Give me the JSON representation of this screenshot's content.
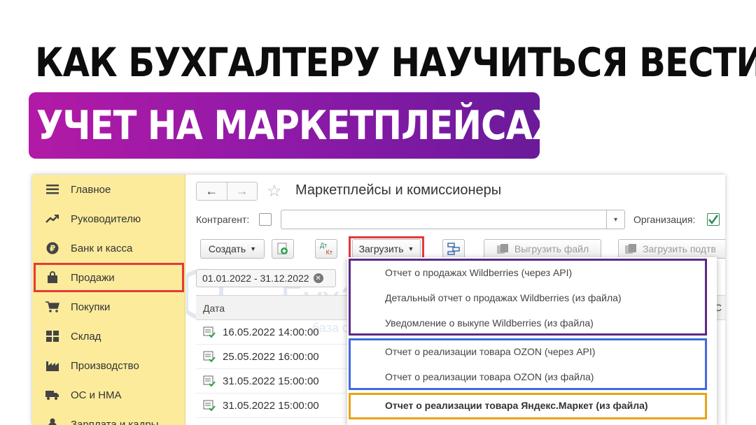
{
  "headline": {
    "line1": "КАК БУХГАЛТЕРУ НАУЧИТЬСЯ ВЕСТИ",
    "line2": "УЧЕТ НА МАРКЕТПЛЕЙСАХ"
  },
  "colors": {
    "banner_gradient": [
      "#b21aa6",
      "#6a1a9a"
    ],
    "sidebar_bg": "#fbeb9b",
    "highlight_red": "#e33a3a",
    "highlight_purple": "#5b2a86",
    "highlight_blue": "#4169e1",
    "highlight_orange": "#e8a317"
  },
  "sidebar": {
    "items": [
      {
        "label": "Главное",
        "icon": "menu-icon"
      },
      {
        "label": "Руководителю",
        "icon": "trend-icon"
      },
      {
        "label": "Банк и касса",
        "icon": "ruble-icon"
      },
      {
        "label": "Продажи",
        "icon": "shopping-bag-icon",
        "active": true
      },
      {
        "label": "Покупки",
        "icon": "cart-icon"
      },
      {
        "label": "Склад",
        "icon": "warehouse-icon"
      },
      {
        "label": "Производство",
        "icon": "factory-icon"
      },
      {
        "label": "ОС и НМА",
        "icon": "truck-icon"
      },
      {
        "label": "Зарплата и кадры",
        "icon": "person-icon"
      }
    ]
  },
  "window": {
    "title": "Маркетплейсы и комиссионеры",
    "nav_back": "←",
    "nav_forward": "→",
    "star": "☆"
  },
  "filters": {
    "counterparty_label": "Контрагент:",
    "counterparty_value": "",
    "organization_label": "Организация:"
  },
  "toolbar": {
    "create": "Создать",
    "dtkt_top": "Дт",
    "dtkt_bottom": "Кт",
    "load": "Загрузить",
    "export_file": "Выгрузить файл",
    "load_confirm": "Загрузить подтв"
  },
  "period": "01.01.2022 - 31.12.2022",
  "table": {
    "headers": [
      "Дата",
      "С"
    ],
    "rows": [
      "16.05.2022 14:00:00",
      "25.05.2022 16:00:00",
      "31.05.2022 15:00:00",
      "31.05.2022 15:00:00"
    ]
  },
  "load_menu": {
    "items": [
      "Отчет о продажах Wildberries (через API)",
      "Детальный отчет о продажах Wildberries (из файла)",
      "Уведомление о выкупе Wildberries (из файла)",
      "Отчет о реализации товара OZON (через API)",
      "Отчет о реализации товара OZON (из файла)",
      "Отчет о реализации товара Яндекс.Маркет (из файла)"
    ]
  },
  "watermark": {
    "brand": "БухЭксперт",
    "digit": "8",
    "tagline": "база ответов по учету в 1С"
  }
}
